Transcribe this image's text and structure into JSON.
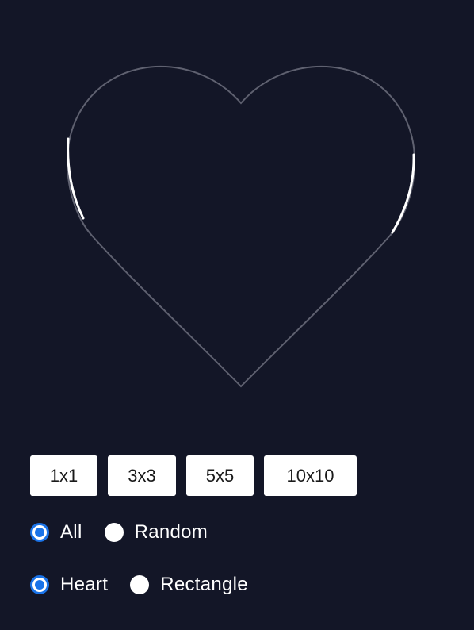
{
  "grid_buttons": [
    "1x1",
    "3x3",
    "5x5",
    "10x10"
  ],
  "selection_mode": {
    "options": [
      "All",
      "Random"
    ],
    "selected": "All"
  },
  "shape": {
    "options": [
      "Heart",
      "Rectangle"
    ],
    "selected": "Heart"
  },
  "colors": {
    "background": "#131627",
    "outline": "#5f6170",
    "highlight": "#ffffff",
    "accent": "#1a73e8"
  }
}
